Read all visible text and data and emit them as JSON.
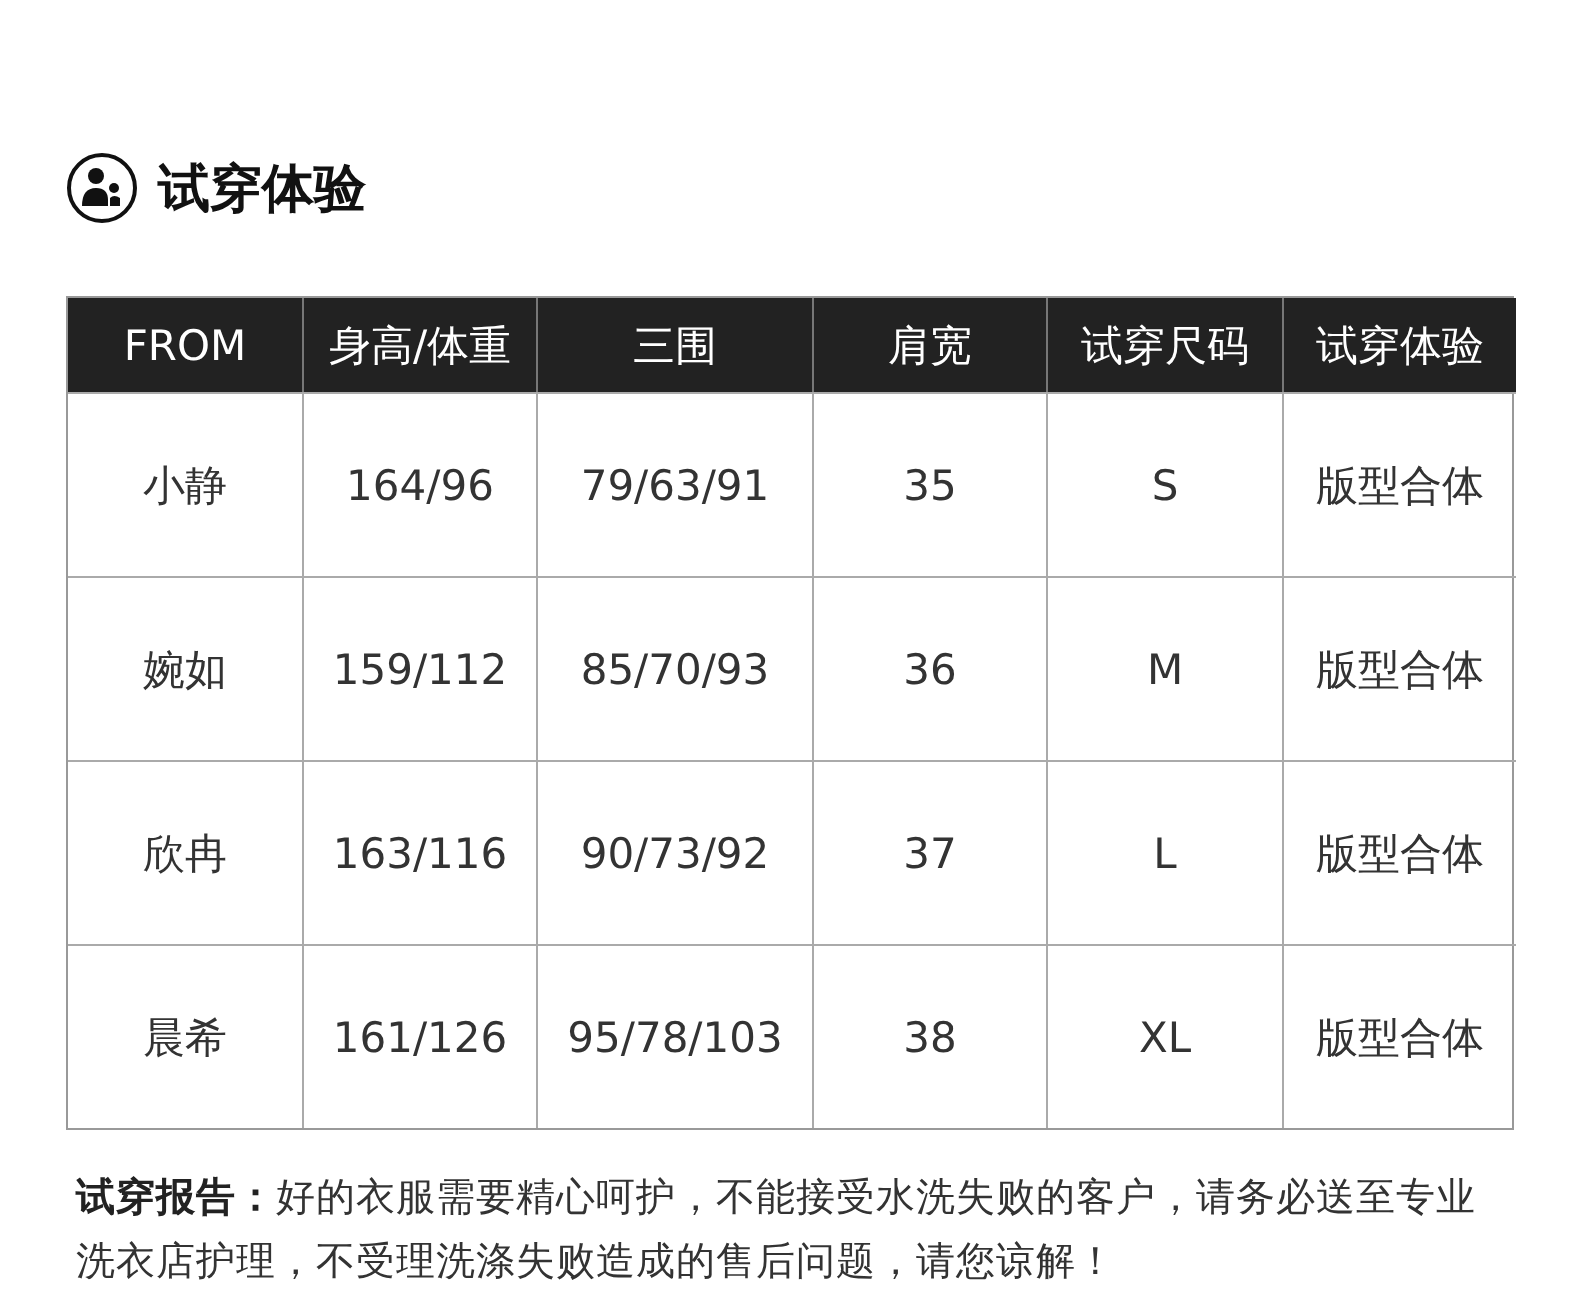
{
  "section": {
    "title": "试穿体验"
  },
  "table": {
    "columns": [
      "FROM",
      "身高/体重",
      "三围",
      "肩宽",
      "试穿尺码",
      "试穿体验"
    ],
    "rows": [
      [
        "小静",
        "164/96",
        "79/63/91",
        "35",
        "S",
        "版型合体"
      ],
      [
        "婉如",
        "159/112",
        "85/70/93",
        "36",
        "M",
        "版型合体"
      ],
      [
        "欣冉",
        "163/116",
        "90/73/92",
        "37",
        "L",
        "版型合体"
      ],
      [
        "晨希",
        "161/126",
        "95/78/103",
        "38",
        "XL",
        "版型合体"
      ]
    ]
  },
  "note": "**试穿报告：**好的衣服需要精心呵护，不能接受水洗失败的客户，请务必送至专业洗衣店护理，不受理洗涤失败造成的售后问题，请您谅解！"
}
